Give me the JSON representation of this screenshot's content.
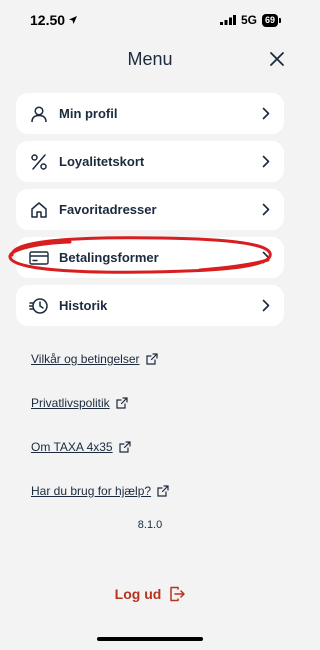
{
  "status_bar": {
    "time": "12.50",
    "network": "5G",
    "battery": "69"
  },
  "header": {
    "title": "Menu"
  },
  "menu": {
    "items": [
      {
        "label": "Min profil",
        "icon": "user-icon"
      },
      {
        "label": "Loyalitetskort",
        "icon": "percent-icon"
      },
      {
        "label": "Favoritadresser",
        "icon": "home-icon"
      },
      {
        "label": "Betalingsformer",
        "icon": "credit-card-icon"
      },
      {
        "label": "Historik",
        "icon": "history-icon"
      }
    ]
  },
  "links": [
    {
      "label": "Vilkår og betingelser"
    },
    {
      "label": "Privatlivspolitik"
    },
    {
      "label": "Om TAXA 4x35"
    },
    {
      "label": "Har du brug for hjælp?"
    }
  ],
  "version": "8.1.0",
  "logout": {
    "label": "Log ud"
  },
  "colors": {
    "text": "#1b2a3d",
    "accent": "#b5341f",
    "annotation": "#d81e1e",
    "background": "#f3f3f4"
  }
}
